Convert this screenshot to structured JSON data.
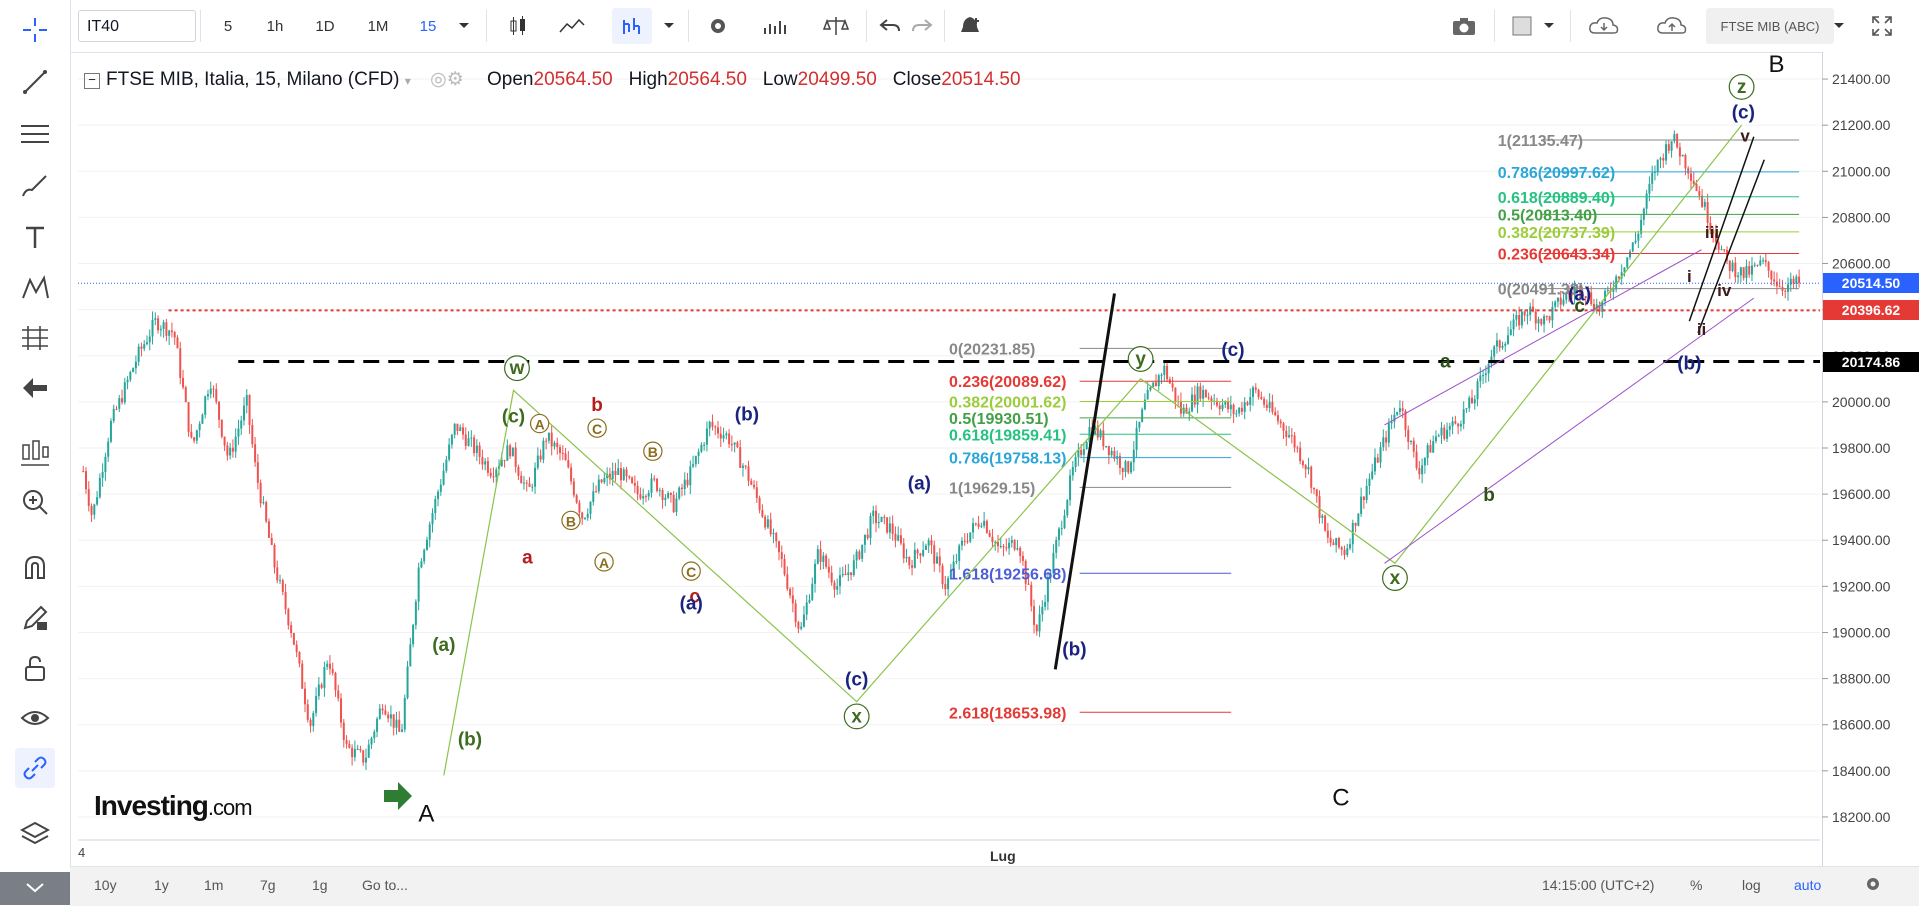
{
  "toolbar": {
    "symbol": "IT40",
    "intervals": [
      "5",
      "1h",
      "1D",
      "1M",
      "15"
    ],
    "active_interval": "15",
    "right_symbol": "FTSE MIB (ABC)"
  },
  "legend": {
    "title": "FTSE MIB, Italia, 15, Milano (CFD)",
    "open_label": "Open",
    "open": "20564.50",
    "high_label": "High",
    "high": "20564.50",
    "low_label": "Low",
    "low": "20499.50",
    "close_label": "Close",
    "close": "20514.50"
  },
  "price_tags": {
    "last": "20514.50",
    "red_level": "20396.62",
    "black_level": "20174.86"
  },
  "bottom": {
    "ranges": [
      "10y",
      "1y",
      "1m",
      "7g",
      "1g"
    ],
    "goto": "Go to...",
    "time": "14:15:00 (UTC+2)",
    "percent": "%",
    "log": "log",
    "auto": "auto"
  },
  "logo": {
    "main": "Investing",
    "suffix": ".com"
  },
  "colors": {
    "accent": "#2962ff",
    "up": "#26a69a",
    "down": "#ef5350",
    "last_price": "#2962ff",
    "red_level": "#e53935"
  },
  "chart_data": {
    "type": "candlestick",
    "title": "FTSE MIB, Italia, 15, Milano (CFD)",
    "ylim": [
      18100,
      21500
    ],
    "y_ticks": [
      18200,
      18400,
      18600,
      18800,
      19000,
      19200,
      19400,
      19600,
      19800,
      20000,
      20200,
      20400,
      20600,
      20800,
      21000,
      21200,
      21400
    ],
    "y_tick_labels": [
      "18200.00",
      "18400.00",
      "18600.00",
      "18800.00",
      "19000.00",
      "19200.00",
      "19400.00",
      "19600.00",
      "19800.00",
      "20000.00",
      "20200.00",
      "20400.00",
      "20600.00",
      "20800.00",
      "21000.00",
      "21200.00",
      "21400.00"
    ],
    "x_label_visible": [
      "4",
      "Lug"
    ],
    "price_path": [
      [
        0,
        19700
      ],
      [
        1,
        19500
      ],
      [
        3,
        19900
      ],
      [
        6,
        20200
      ],
      [
        8,
        20350
      ],
      [
        10,
        20300
      ],
      [
        12,
        19800
      ],
      [
        14,
        20100
      ],
      [
        16,
        19750
      ],
      [
        18,
        20000
      ],
      [
        19,
        19700
      ],
      [
        21,
        19300
      ],
      [
        23,
        19000
      ],
      [
        25,
        18600
      ],
      [
        27,
        18900
      ],
      [
        29,
        18500
      ],
      [
        31,
        18450
      ],
      [
        33,
        18700
      ],
      [
        35,
        18550
      ],
      [
        37,
        19300
      ],
      [
        39,
        19600
      ],
      [
        41,
        19900
      ],
      [
        43,
        19800
      ],
      [
        45,
        19700
      ],
      [
        47,
        19800
      ],
      [
        49,
        19600
      ],
      [
        51,
        19850
      ],
      [
        53,
        19750
      ],
      [
        55,
        19500
      ],
      [
        57,
        19650
      ],
      [
        59,
        19700
      ],
      [
        61,
        19600
      ],
      [
        63,
        19650
      ],
      [
        65,
        19550
      ],
      [
        67,
        19700
      ],
      [
        69,
        19900
      ],
      [
        71,
        19850
      ],
      [
        73,
        19700
      ],
      [
        75,
        19500
      ],
      [
        77,
        19300
      ],
      [
        79,
        19000
      ],
      [
        81,
        19350
      ],
      [
        83,
        19200
      ],
      [
        85,
        19300
      ],
      [
        87,
        19500
      ],
      [
        89,
        19450
      ],
      [
        91,
        19300
      ],
      [
        93,
        19400
      ],
      [
        95,
        19200
      ],
      [
        97,
        19400
      ],
      [
        99,
        19500
      ],
      [
        101,
        19350
      ],
      [
        103,
        19400
      ],
      [
        105,
        19000
      ],
      [
        107,
        19350
      ],
      [
        109,
        19700
      ],
      [
        111,
        19900
      ],
      [
        113,
        19800
      ],
      [
        115,
        19700
      ],
      [
        117,
        20000
      ],
      [
        119,
        20150
      ],
      [
        121,
        19950
      ],
      [
        123,
        20050
      ],
      [
        125,
        20000
      ],
      [
        127,
        19950
      ],
      [
        129,
        20050
      ],
      [
        131,
        19950
      ],
      [
        133,
        19850
      ],
      [
        135,
        19700
      ],
      [
        137,
        19400
      ],
      [
        139,
        19350
      ],
      [
        141,
        19600
      ],
      [
        143,
        19800
      ],
      [
        145,
        20000
      ],
      [
        147,
        19700
      ],
      [
        149,
        19850
      ],
      [
        151,
        19900
      ],
      [
        153,
        20000
      ],
      [
        155,
        20200
      ],
      [
        157,
        20300
      ],
      [
        159,
        20400
      ],
      [
        161,
        20350
      ],
      [
        163,
        20450
      ],
      [
        165,
        20500
      ],
      [
        167,
        20400
      ],
      [
        169,
        20550
      ],
      [
        171,
        20700
      ],
      [
        173,
        21000
      ],
      [
        175,
        21150
      ],
      [
        177,
        21000
      ],
      [
        179,
        20800
      ],
      [
        181,
        20600
      ],
      [
        183,
        20550
      ],
      [
        185,
        20600
      ],
      [
        187,
        20500
      ],
      [
        189,
        20514
      ]
    ],
    "levels": {
      "red_dotted": 20396.62,
      "black_dashed": 20174.86,
      "last_price": 20514.5
    },
    "fib_left": [
      {
        "label": "0(20231.85)",
        "color": "#888888",
        "value": 20231.85
      },
      {
        "label": "0.236(20089.62)",
        "color": "#e53935",
        "value": 20089.62
      },
      {
        "label": "0.382(20001.62)",
        "color": "#9ccc3c",
        "value": 20001.62
      },
      {
        "label": "0.5(19930.51)",
        "color": "#43a047",
        "value": 19930.51
      },
      {
        "label": "0.618(19859.41)",
        "color": "#26c281",
        "value": 19859.41
      },
      {
        "label": "0.786(19758.13)",
        "color": "#2ba6d9",
        "value": 19758.13
      },
      {
        "label": "1(19629.15)",
        "color": "#888888",
        "value": 19629.15
      },
      {
        "label": "1.618(19256.68)",
        "color": "#4c5fd7",
        "value": 19256.68
      },
      {
        "label": "2.618(18653.98)",
        "color": "#e53935",
        "value": 18653.98
      }
    ],
    "fib_right": [
      {
        "label": "1(21135.47)",
        "color": "#888888",
        "value": 21135.47
      },
      {
        "label": "0.786(20997.62)",
        "color": "#2ba6d9",
        "value": 20997.62
      },
      {
        "label": "0.618(20889.40)",
        "color": "#26c281",
        "value": 20889.4
      },
      {
        "label": "0.5(20813.40)",
        "color": "#43a047",
        "value": 20813.4
      },
      {
        "label": "0.382(20737.39)",
        "color": "#9ccc3c",
        "value": 20737.39
      },
      {
        "label": "0.236(20643.34)",
        "color": "#e53935",
        "value": 20643.34
      },
      {
        "label": "0(20491.33)",
        "color": "#888888",
        "value": 20491.33
      }
    ],
    "wave_labels": [
      {
        "t": "A",
        "color": "#111111",
        "x": 0.2,
        "y": 18180,
        "size": 24,
        "style": "plain"
      },
      {
        "t": "B",
        "color": "#111111",
        "x": 0.975,
        "y": 21430,
        "size": 24,
        "style": "plain"
      },
      {
        "t": "C",
        "color": "#111111",
        "x": 0.725,
        "y": 18250,
        "size": 24,
        "style": "plain"
      },
      {
        "t": "(a)",
        "color": "#3e6b1f",
        "x": 0.21,
        "y": 18920,
        "size": 19,
        "style": "plain"
      },
      {
        "t": "(b)",
        "color": "#3e6b1f",
        "x": 0.225,
        "y": 18510,
        "size": 19,
        "style": "plain"
      },
      {
        "t": "(c)",
        "color": "#3e6b1f",
        "x": 0.25,
        "y": 19910,
        "size": 19,
        "style": "plain"
      },
      {
        "t": "w",
        "color": "#3e6b1f",
        "x": 0.252,
        "y": 20120,
        "size": 19,
        "style": "circle"
      },
      {
        "t": "a",
        "color": "#b71c1c",
        "x": 0.258,
        "y": 19300,
        "size": 19,
        "style": "plain"
      },
      {
        "t": "b",
        "color": "#b71c1c",
        "x": 0.298,
        "y": 19960,
        "size": 19,
        "style": "plain"
      },
      {
        "t": "c",
        "color": "#b71c1c",
        "x": 0.354,
        "y": 19130,
        "size": 19,
        "style": "plain"
      },
      {
        "t": "A",
        "color": "#8a6d1e",
        "x": 0.265,
        "y": 19880,
        "size": 14,
        "style": "circle"
      },
      {
        "t": "B",
        "color": "#8a6d1e",
        "x": 0.283,
        "y": 19460,
        "size": 14,
        "style": "circle"
      },
      {
        "t": "A",
        "color": "#8a6d1e",
        "x": 0.302,
        "y": 19280,
        "size": 14,
        "style": "circle"
      },
      {
        "t": "C",
        "color": "#8a6d1e",
        "x": 0.298,
        "y": 19860,
        "size": 14,
        "style": "circle"
      },
      {
        "t": "B",
        "color": "#8a6d1e",
        "x": 0.33,
        "y": 19760,
        "size": 14,
        "style": "circle"
      },
      {
        "t": "C",
        "color": "#8a6d1e",
        "x": 0.352,
        "y": 19240,
        "size": 14,
        "style": "circle"
      },
      {
        "t": "(a)",
        "color": "#1a237e",
        "x": 0.352,
        "y": 19100,
        "size": 19,
        "style": "plain"
      },
      {
        "t": "(b)",
        "color": "#1a237e",
        "x": 0.384,
        "y": 19920,
        "size": 19,
        "style": "plain"
      },
      {
        "t": "(c)",
        "color": "#1a237e",
        "x": 0.447,
        "y": 18770,
        "size": 19,
        "style": "plain"
      },
      {
        "t": "x",
        "color": "#3e6b1f",
        "x": 0.447,
        "y": 18610,
        "size": 19,
        "style": "circle"
      },
      {
        "t": "(a)",
        "color": "#1a237e",
        "x": 0.483,
        "y": 19620,
        "size": 19,
        "style": "plain"
      },
      {
        "t": "(b)",
        "color": "#1a237e",
        "x": 0.572,
        "y": 18900,
        "size": 19,
        "style": "plain"
      },
      {
        "t": "(c)",
        "color": "#1a237e",
        "x": 0.663,
        "y": 20200,
        "size": 19,
        "style": "plain"
      },
      {
        "t": "y",
        "color": "#3e6b1f",
        "x": 0.61,
        "y": 20160,
        "size": 19,
        "style": "circle"
      },
      {
        "t": "x",
        "color": "#3e6b1f",
        "x": 0.756,
        "y": 19210,
        "size": 19,
        "style": "circle"
      },
      {
        "t": "a",
        "color": "#2e5117",
        "x": 0.785,
        "y": 20150,
        "size": 19,
        "style": "plain"
      },
      {
        "t": "b",
        "color": "#2e5117",
        "x": 0.81,
        "y": 19570,
        "size": 19,
        "style": "plain"
      },
      {
        "t": "c",
        "color": "#2e5117",
        "x": 0.862,
        "y": 20390,
        "size": 19,
        "style": "plain"
      },
      {
        "t": "(a)",
        "color": "#1a237e",
        "x": 0.862,
        "y": 20440,
        "size": 19,
        "style": "plain"
      },
      {
        "t": "(b)",
        "color": "#1a237e",
        "x": 0.925,
        "y": 20140,
        "size": 19,
        "style": "plain"
      },
      {
        "t": "(c)",
        "color": "#1a237e",
        "x": 0.956,
        "y": 21230,
        "size": 19,
        "style": "plain"
      },
      {
        "t": "z",
        "color": "#3e6b1f",
        "x": 0.955,
        "y": 21340,
        "size": 19,
        "style": "circle"
      },
      {
        "t": "i",
        "color": "#3e1a1a",
        "x": 0.925,
        "y": 20520,
        "size": 17,
        "style": "plain"
      },
      {
        "t": "ii",
        "color": "#3e1a1a",
        "x": 0.932,
        "y": 20290,
        "size": 17,
        "style": "plain"
      },
      {
        "t": "iii",
        "color": "#3e1a1a",
        "x": 0.938,
        "y": 20710,
        "size": 17,
        "style": "plain"
      },
      {
        "t": "iv",
        "color": "#3e1a1a",
        "x": 0.945,
        "y": 20460,
        "size": 17,
        "style": "plain"
      },
      {
        "t": "v",
        "color": "#3e1a1a",
        "x": 0.957,
        "y": 21130,
        "size": 17,
        "style": "plain"
      }
    ]
  }
}
